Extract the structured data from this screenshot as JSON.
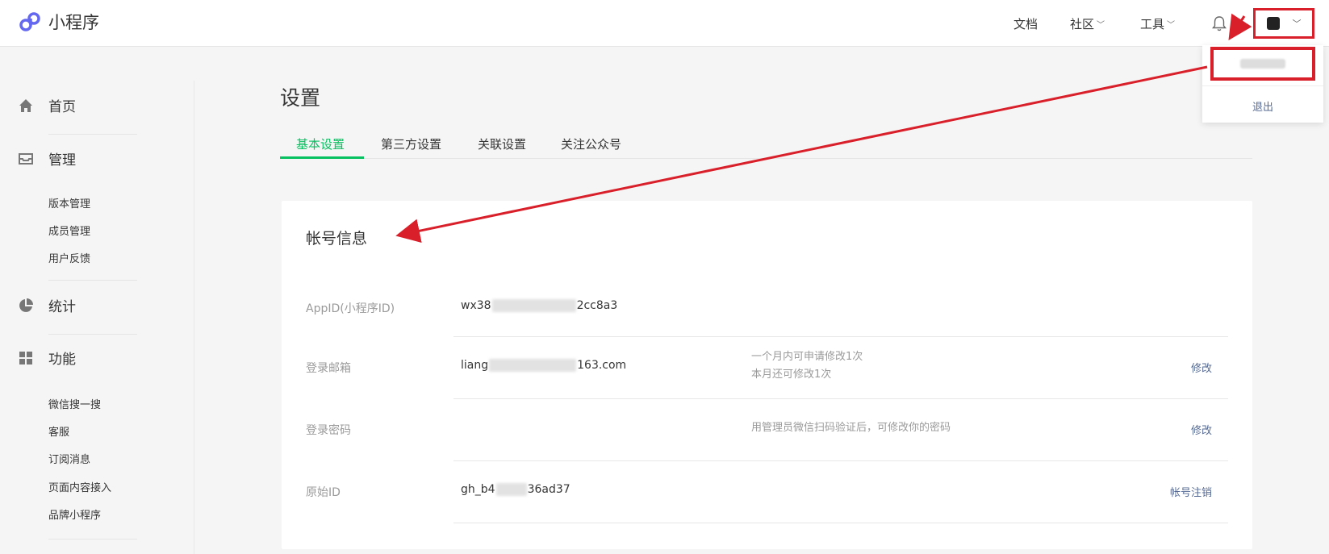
{
  "app": {
    "logo_text": "小程序"
  },
  "nav": {
    "docs": "文档",
    "community": "社区",
    "tools": "工具"
  },
  "dropdown": {
    "logout": "退出"
  },
  "sidebar": {
    "home": "首页",
    "manage": "管理",
    "manage_items": [
      "版本管理",
      "成员管理",
      "用户反馈"
    ],
    "stats": "统计",
    "features": "功能",
    "feature_items": [
      "微信搜一搜",
      "客服",
      "订阅消息",
      "页面内容接入",
      "品牌小程序"
    ]
  },
  "page": {
    "title": "设置",
    "tabs": [
      "基本设置",
      "第三方设置",
      "关联设置",
      "关注公众号"
    ]
  },
  "account": {
    "title": "帐号信息",
    "rows": [
      {
        "label": "AppID(小程序ID)",
        "value_start": "wx38",
        "value_end": "2cc8a3"
      },
      {
        "label": "登录邮箱",
        "value_start": "liang",
        "value_end": "163.com",
        "hint1": "一个月内可申请修改1次",
        "hint2": "本月还可修改1次",
        "action": "修改"
      },
      {
        "label": "登录密码",
        "hint1": "用管理员微信扫码验证后，可修改你的密码",
        "action": "修改"
      },
      {
        "label": "原始ID",
        "value_start": "gh_b4",
        "value_end": "36ad37",
        "action": "帐号注销"
      }
    ]
  },
  "colors": {
    "accent": "#07c160",
    "link": "#576b95",
    "annotation": "#d9202a"
  }
}
